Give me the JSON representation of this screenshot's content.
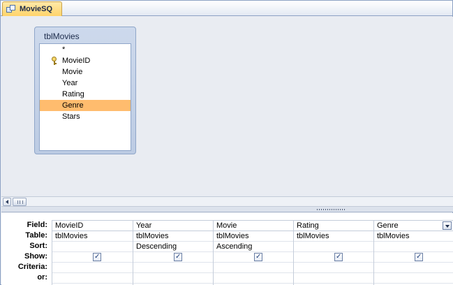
{
  "document_tab": {
    "label": "MovieSQ",
    "icon": "query-icon"
  },
  "table_box": {
    "title": "tblMovies",
    "fields": [
      {
        "label": "*",
        "primary_key": false,
        "selected": false
      },
      {
        "label": "MovieID",
        "primary_key": true,
        "selected": false
      },
      {
        "label": "Movie",
        "primary_key": false,
        "selected": false
      },
      {
        "label": "Year",
        "primary_key": false,
        "selected": false
      },
      {
        "label": "Rating",
        "primary_key": false,
        "selected": false
      },
      {
        "label": "Genre",
        "primary_key": false,
        "selected": true
      },
      {
        "label": "Stars",
        "primary_key": false,
        "selected": false
      }
    ]
  },
  "grid": {
    "row_labels": [
      "Field:",
      "Table:",
      "Sort:",
      "Show:",
      "Criteria:",
      "or:"
    ],
    "columns": [
      {
        "field": "MovieID",
        "table": "tblMovies",
        "sort": "",
        "show": true,
        "criteria": "",
        "or": ""
      },
      {
        "field": "Year",
        "table": "tblMovies",
        "sort": "Descending",
        "show": true,
        "criteria": "",
        "or": ""
      },
      {
        "field": "Movie",
        "table": "tblMovies",
        "sort": "Ascending",
        "show": true,
        "criteria": "",
        "or": ""
      },
      {
        "field": "Rating",
        "table": "tblMovies",
        "sort": "",
        "show": true,
        "criteria": "",
        "or": ""
      },
      {
        "field": "Genre",
        "table": "tblMovies",
        "sort": "",
        "show": true,
        "criteria": "",
        "or": "",
        "has_dropdown": true
      }
    ]
  },
  "colors": {
    "selected_field": "#ffbc6e",
    "tab_active": "#ffd36a",
    "pane_background": "#e9ecf2",
    "border": "#8da2c4"
  }
}
